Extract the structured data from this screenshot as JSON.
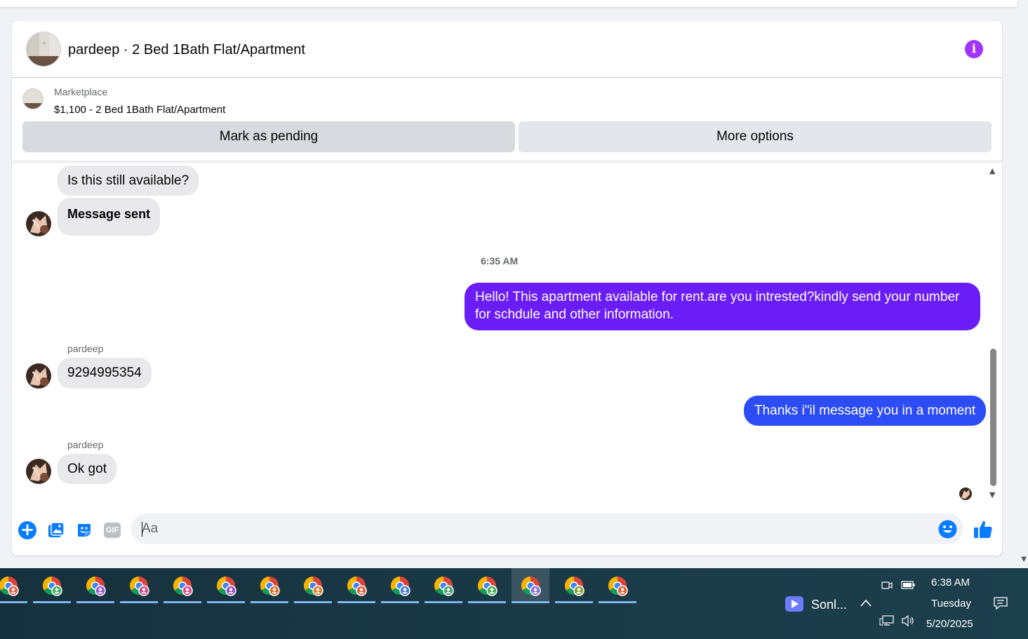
{
  "conversation": {
    "title": "pardeep · 2 Bed 1Bath Flat/Apartment",
    "listing": {
      "source_label": "Marketplace",
      "price_title": "$1,100 - 2 Bed 1Bath Flat/Apartment"
    },
    "actions": {
      "mark_pending": "Mark as pending",
      "more_options": "More options"
    }
  },
  "messages": {
    "m1": {
      "text": "Is this still available?",
      "direction": "incoming"
    },
    "m2": {
      "text": "Message sent",
      "direction": "incoming"
    },
    "timestamp": "6:35 AM",
    "m3": {
      "text": "Hello! This apartment available for rent.are you intrested?kindly send your number for schdule and other information.",
      "direction": "outgoing"
    },
    "m4": {
      "sender": "pardeep",
      "text": "9294995354",
      "direction": "incoming"
    },
    "m5": {
      "text": "Thanks i\"il message you in a moment",
      "direction": "outgoing"
    },
    "m6": {
      "sender": "pardeep",
      "text": "Ok got",
      "direction": "incoming"
    }
  },
  "composer": {
    "placeholder": "Aa",
    "icons": [
      "plus-icon",
      "photo-icon",
      "sticker-icon",
      "gif-icon",
      "emoji-icon",
      "thumbs-up-icon"
    ],
    "gif_label": "GIF"
  },
  "taskbar": {
    "app_count": 15,
    "active_index": 12,
    "media_app_label": "Sonl...",
    "clock_time": "6:38 AM",
    "clock_day": "Tuesday",
    "clock_date": "5/20/2025"
  },
  "colors": {
    "outgoing_purple": "#6a1df7",
    "outgoing_blue": "#2c4cf5",
    "incoming_gray": "#e9e9eb",
    "accent_blue": "#0a7cff",
    "info_purple": "#a033ff"
  }
}
